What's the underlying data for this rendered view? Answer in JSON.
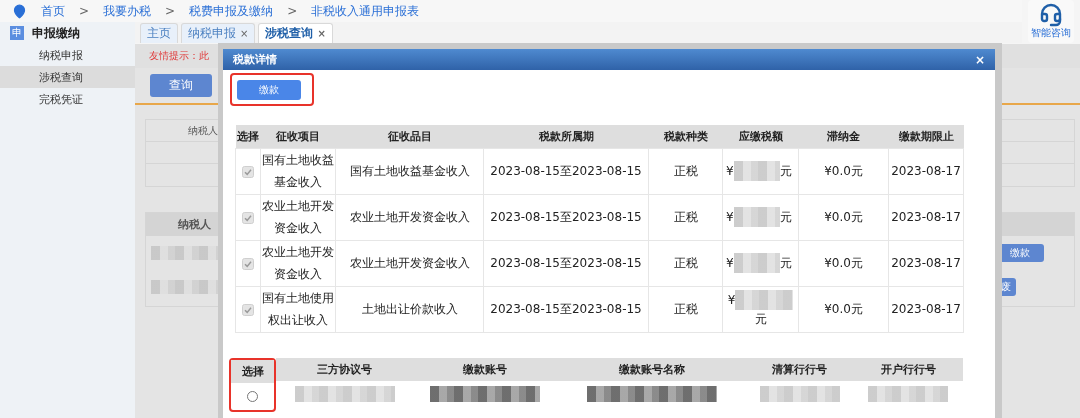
{
  "breadcrumb": {
    "separator": ">",
    "items": [
      "首页",
      "我要办税",
      "税费申报及缴纳",
      "非税收入通用申报表"
    ]
  },
  "assistant": {
    "label": "智能咨询"
  },
  "sidebar": {
    "icon": "申",
    "title": "申报缴纳",
    "items": [
      {
        "label": "纳税申报",
        "selected": false
      },
      {
        "label": "涉税查询",
        "selected": true
      },
      {
        "label": "完税凭证",
        "selected": false
      }
    ]
  },
  "tabs": [
    {
      "label": "主页",
      "closable": false,
      "selected": false
    },
    {
      "label": "纳税申报",
      "closable": true,
      "selected": false
    },
    {
      "label": "涉税查询",
      "closable": true,
      "selected": true
    }
  ],
  "tab_close": "×",
  "background": {
    "notice": "友情提示：此",
    "query_button": "查询",
    "field_label": "纳税人",
    "section_title": "纳税人",
    "pay_button": "缴款",
    "void_button": "废"
  },
  "dialog": {
    "title": "税款详情",
    "close": "×",
    "pay_button": {
      "label": "缴款",
      "highlighted": true
    },
    "tax_table": {
      "columns": [
        "选择",
        "征收项目",
        "征收品目",
        "税款所属期",
        "税款种类",
        "应缴税额",
        "滞纳金",
        "缴款期限止"
      ],
      "rows": [
        {
          "checked": true,
          "item": "国有土地收益基金收入",
          "category": "国有土地收益基金收入",
          "period": "2023-08-15至2023-08-15",
          "type": "正税",
          "amount_prefix": "¥",
          "amount_suffix": "元",
          "amount_wrapped": false,
          "late_fee": "¥0.0元",
          "deadline": "2023-08-17"
        },
        {
          "checked": true,
          "item": "农业土地开发资金收入",
          "category": "农业土地开发资金收入",
          "period": "2023-08-15至2023-08-15",
          "type": "正税",
          "amount_prefix": "¥",
          "amount_suffix": "元",
          "amount_wrapped": false,
          "late_fee": "¥0.0元",
          "deadline": "2023-08-17"
        },
        {
          "checked": true,
          "item": "农业土地开发资金收入",
          "category": "农业土地开发资金收入",
          "period": "2023-08-15至2023-08-15",
          "type": "正税",
          "amount_prefix": "¥",
          "amount_suffix": "元",
          "amount_wrapped": false,
          "late_fee": "¥0.0元",
          "deadline": "2023-08-17"
        },
        {
          "checked": true,
          "item": "国有土地使用权出让收入",
          "category": "土地出让价款收入",
          "period": "2023-08-15至2023-08-15",
          "type": "正税",
          "amount_prefix": "¥",
          "amount_suffix": "元",
          "amount_wrapped": true,
          "late_fee": "¥0.0元",
          "deadline": "2023-08-17"
        }
      ]
    },
    "account_table": {
      "select_highlighted": true,
      "columns": [
        "选择",
        "三方协议号",
        "缴款账号",
        "缴款账号名称",
        "清算行行号",
        "开户行行号"
      ],
      "rows": [
        {
          "selected": false
        }
      ]
    }
  }
}
